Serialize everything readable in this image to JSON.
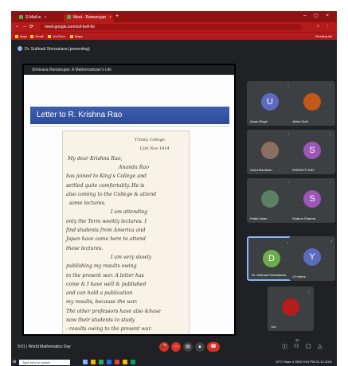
{
  "browser": {
    "tabs": [
      {
        "label": "S-Mail.io"
      },
      {
        "label": "Meet - Ramanujan"
      }
    ],
    "new_tab": "+",
    "window_controls": "– ▢ ×",
    "url": "meet.google.com/xsf-bvtf-fxt",
    "address_right": "☆ ⋮",
    "bookmarks": [
      "Apps",
      "Gmail",
      "YouTube",
      "Maps"
    ],
    "bookmarks_right": "Reading list"
  },
  "meet": {
    "presenting_text": "Dr. Subhadi Shrivastava (presenting)",
    "slide": {
      "sharer": "Srinivasa Ramanujan: A Mathematician's Life",
      "title": "Letter to R. Krishna Rao",
      "letter_lines": [
        "Trinity College,",
        "12th Nov 1914",
        "My dear Krishna Rao,",
        "Ananda Rao",
        "has joined to King's College and",
        "settled quite comfortably. He is",
        "also coming to the College & attend",
        "some lectures.",
        "I am attending",
        "only the Term weekly lectures. I",
        "find students from America and",
        "Japan have come here to attend",
        "these lectures.",
        "I am very slowly",
        "publishing my results owing",
        "to the present war. A letter has",
        "come & I have well & published",
        "and can hold a publication",
        "my results, because the war.",
        "The other professors have also &have",
        "now their students to study",
        "- results owing to the present war."
      ]
    },
    "participants": [
      {
        "name": "Aman Singh",
        "initial": "U",
        "color": "#5c6bc0",
        "muted": true
      },
      {
        "name": "Jolina Dudi",
        "initial": "",
        "color": "#c2571a",
        "muted": true
      },
      {
        "name": "Gokul Bandhan",
        "initial": "",
        "color": "#8d6e63",
        "muted": true
      },
      {
        "name": "SHRISHTI RAY",
        "initial": "S",
        "color": "#9c56b8",
        "muted": true
      },
      {
        "name": "Pratik Kalan",
        "initial": "",
        "color": "#5d7f64",
        "muted": true
      },
      {
        "name": "Shabna Sharma",
        "initial": "S",
        "color": "#9c56b8",
        "muted": true
      },
      {
        "name": "Dr. Subhadi Shrivastava",
        "initial": "D",
        "color": "#6bae4a",
        "muted": false,
        "active": true
      },
      {
        "name": "13 others",
        "initial": "Y",
        "color": "#5c6bc0",
        "muted": false
      },
      {
        "name": "You",
        "initial": "",
        "color": "#b71c1c",
        "muted": true
      }
    ],
    "bottom_left": "9:01 | World Mathematics Day",
    "controls": [
      "mic-off",
      "camera-off",
      "captions",
      "present",
      "leave"
    ],
    "right_controls": [
      "info",
      "people",
      "chat",
      "activities"
    ],
    "people_count": "22"
  },
  "taskbar": {
    "search_placeholder": "Type here to search",
    "tray": "22°C Haze ∧ ENG 9:01 PM 21-12-2021"
  },
  "colors": {
    "browser_red": "#b51b1b",
    "meet_bg": "#202124",
    "slide_blue": "#2d4a98",
    "leave_red": "#d93025"
  }
}
